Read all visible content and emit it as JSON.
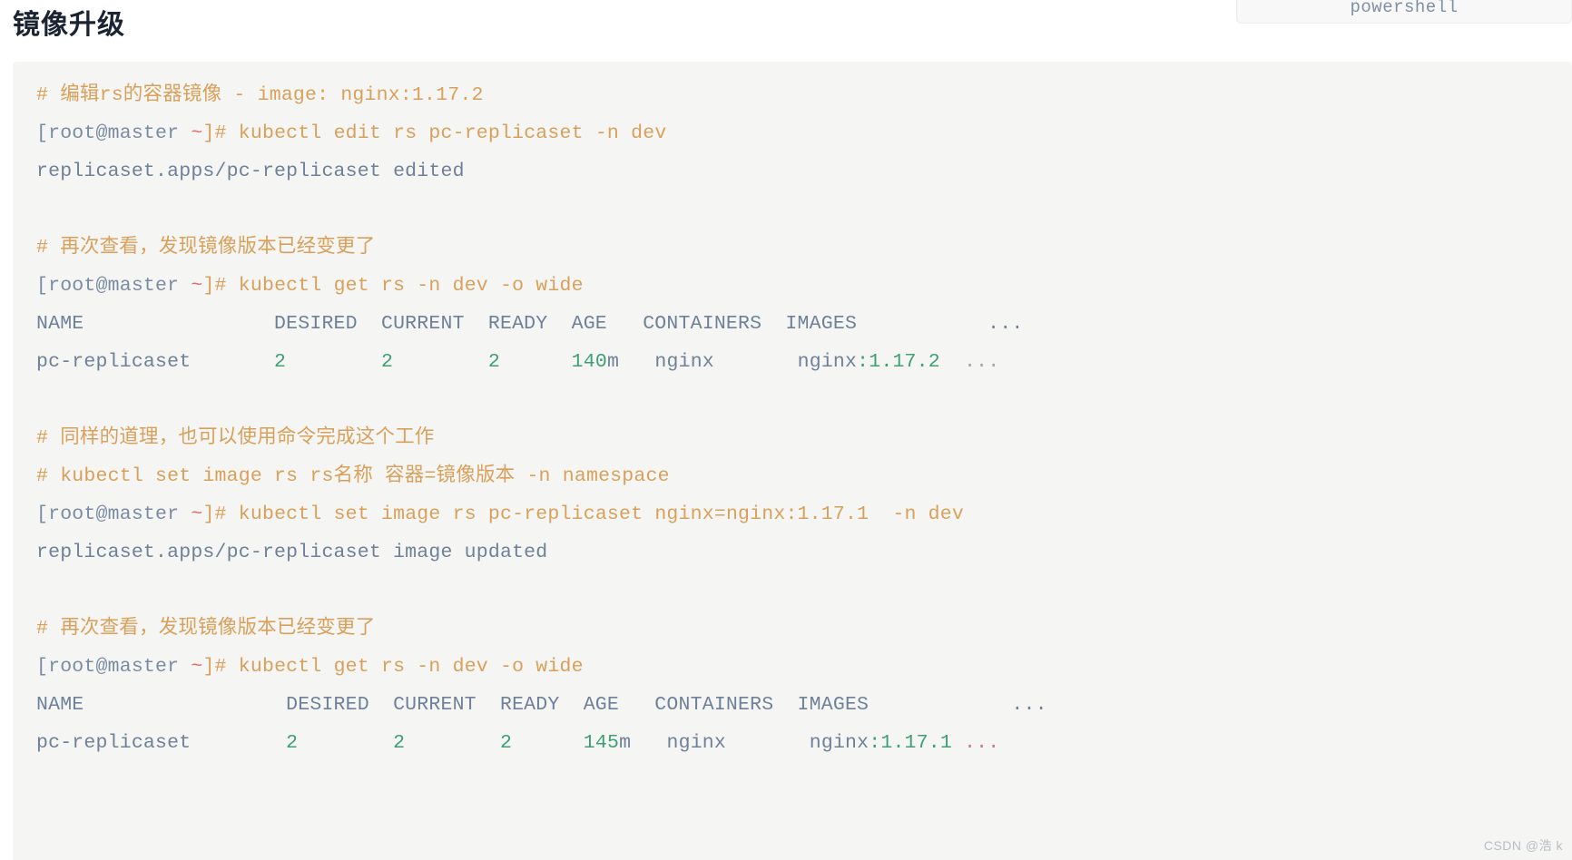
{
  "page": {
    "title": "镜像升级",
    "background": "#ffffff"
  },
  "code_block": {
    "language_label": "powershell",
    "background": "#f5f6f4",
    "colors": {
      "comment": "#d9a05b",
      "prompt": "#7a8ca3",
      "tilde": "#e06c6c",
      "command": "#d9a05b",
      "output": "#6f8099",
      "number": "#3f9e72",
      "ellipsis": "#9aa6b4"
    },
    "lines": [
      {
        "id": "l01",
        "kind": "comment",
        "text": "# 编辑rs的容器镜像 - image: nginx:1.17.2"
      },
      {
        "id": "l02",
        "kind": "command",
        "prompt": "[root@master ",
        "tilde": "~",
        "prompt_end": "]#",
        "text": " kubectl edit rs pc-replicaset -n dev"
      },
      {
        "id": "l03",
        "kind": "output",
        "text": "replicaset.apps/pc-replicaset edited"
      },
      {
        "id": "l04",
        "kind": "blank",
        "text": ""
      },
      {
        "id": "l05",
        "kind": "comment",
        "text": "# 再次查看，发现镜像版本已经变更了"
      },
      {
        "id": "l06",
        "kind": "command",
        "prompt": "[root@master ",
        "tilde": "~",
        "prompt_end": "]#",
        "text": " kubectl get rs -n dev -o wide"
      },
      {
        "id": "l07",
        "kind": "table_header",
        "text": "NAME                DESIRED  CURRENT  READY  AGE   CONTAINERS  IMAGES           ..."
      },
      {
        "id": "l08",
        "kind": "table_row",
        "name": "pc-replicaset",
        "desired": "2",
        "current": "2",
        "ready": "2",
        "age": "140m",
        "containers": "nginx",
        "images_base": "nginx",
        "images_tag": ":1.17.2",
        "ellipsis": "..."
      },
      {
        "id": "l09",
        "kind": "blank",
        "text": ""
      },
      {
        "id": "l10",
        "kind": "comment",
        "text": "# 同样的道理，也可以使用命令完成这个工作"
      },
      {
        "id": "l11",
        "kind": "comment",
        "text": "# kubectl set image rs rs名称 容器=镜像版本 -n namespace"
      },
      {
        "id": "l12",
        "kind": "command",
        "prompt": "[root@master ",
        "tilde": "~",
        "prompt_end": "]#",
        "text": " kubectl set image rs pc-replicaset nginx=nginx:1.17.1  -n dev"
      },
      {
        "id": "l13",
        "kind": "output",
        "text": "replicaset.apps/pc-replicaset image updated"
      },
      {
        "id": "l14",
        "kind": "blank",
        "text": ""
      },
      {
        "id": "l15",
        "kind": "comment",
        "text": "# 再次查看，发现镜像版本已经变更了"
      },
      {
        "id": "l16",
        "kind": "command",
        "prompt": "[root@master ",
        "tilde": "~",
        "prompt_end": "]#",
        "text": " kubectl get rs -n dev -o wide"
      },
      {
        "id": "l17",
        "kind": "table_header",
        "text": "NAME                 DESIRED  CURRENT  READY  AGE   CONTAINERS  IMAGES            ..."
      },
      {
        "id": "l18",
        "kind": "table_row",
        "name": "pc-replicaset",
        "desired": "2",
        "current": "2",
        "ready": "2",
        "age": "145m",
        "containers": "nginx",
        "images_base": "nginx",
        "images_tag": ":1.17.1",
        "ellipsis": "..."
      }
    ]
  },
  "watermark": {
    "text": "CSDN @浩 k"
  }
}
